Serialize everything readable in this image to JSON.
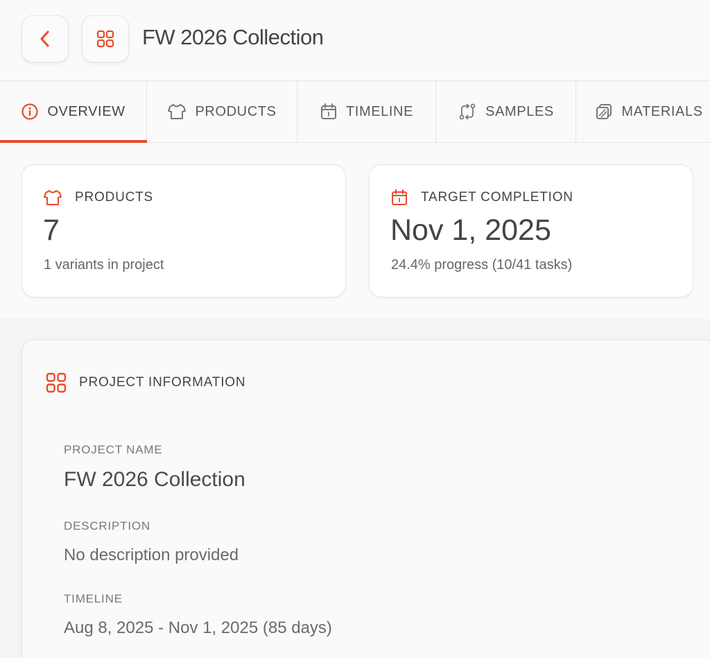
{
  "header": {
    "title": "FW 2026 Collection",
    "back_icon": "chevron-left-icon",
    "project_icon": "grid-icon"
  },
  "tabs": [
    {
      "label": "OVERVIEW",
      "icon": "info-circle-icon",
      "active": true
    },
    {
      "label": "PRODUCTS",
      "icon": "shirt-icon",
      "active": false
    },
    {
      "label": "TIMELINE",
      "icon": "calendar-icon",
      "active": false
    },
    {
      "label": "SAMPLES",
      "icon": "arrows-exchange-icon",
      "active": false
    },
    {
      "label": "MATERIALS",
      "icon": "layers-icon",
      "active": false
    }
  ],
  "stats": {
    "products": {
      "label": "PRODUCTS",
      "value": "7",
      "sub": "1 variants in project",
      "icon": "shirt-icon"
    },
    "completion": {
      "label": "TARGET COMPLETION",
      "value": "Nov 1, 2025",
      "sub": "24.4% progress (10/41 tasks)",
      "icon": "calendar-icon"
    }
  },
  "info": {
    "title": "PROJECT INFORMATION",
    "icon": "grid-icon",
    "project_name_label": "PROJECT NAME",
    "project_name": "FW 2026 Collection",
    "description_label": "DESCRIPTION",
    "description": "No description provided",
    "timeline_label": "TIMELINE",
    "timeline": "Aug 8, 2025 - Nov 1, 2025 (85 days)"
  },
  "colors": {
    "accent": "#e84a2a",
    "text": "#444444",
    "muted": "#777777",
    "background": "#fafafa"
  }
}
